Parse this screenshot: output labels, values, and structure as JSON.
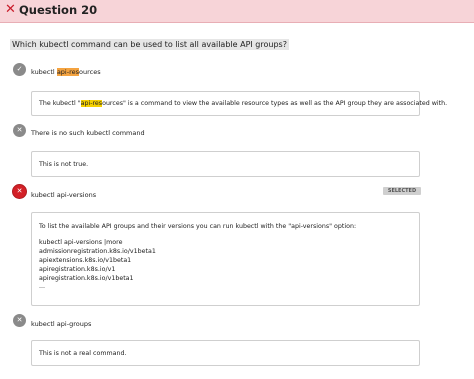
{
  "header": {
    "icon": "close-x-icon",
    "title": "Question 20",
    "background": "#f7d4d8",
    "accent": "#c91c2a"
  },
  "question": {
    "text": "Which kubectl command can be used to list all available API groups?"
  },
  "options": [
    {
      "status_icon": "check-icon",
      "label_pre": "kubectl ",
      "label_hl": "api-res",
      "label_post": "ources",
      "explanation_pre": "The kubectl \"",
      "explanation_hl": "api-res",
      "explanation_post": "ources\" is a command to view the available resource types as well as the API group they are associated with."
    },
    {
      "status_icon": "x-icon",
      "label": "There is no such kubectl command",
      "explanation": "This is not true."
    },
    {
      "status_icon": "x-icon",
      "label": "kubectl api-versions",
      "badge": "SELECTED",
      "explanation_lines": [
        "To list the available API groups and their versions you can run kubectl with the \"api-versions\" option:",
        "kubectl api-versions |more",
        "admissionregistration.k8s.io/v1beta1",
        "apiextensions.k8s.io/v1beta1",
        "apiregistration.k8s.io/v1",
        "apiregistration.k8s.io/v1beta1",
        "..."
      ]
    },
    {
      "status_icon": "x-icon",
      "label": "kubectl api-groups",
      "explanation": "This is not a real command."
    }
  ],
  "colors": {
    "wrong": "#d32027",
    "neutral": "#8a8a8a"
  }
}
